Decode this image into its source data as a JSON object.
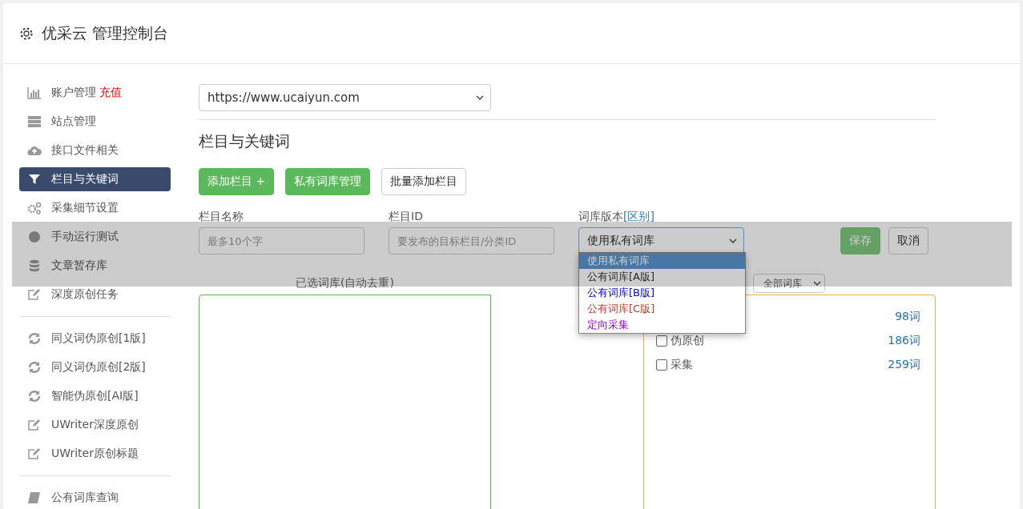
{
  "header": {
    "title": "优采云 管理控制台"
  },
  "sidebar": {
    "groups": [
      [
        {
          "label": "账户管理",
          "badge": "充值",
          "selected": false
        },
        {
          "label": "站点管理",
          "selected": false
        },
        {
          "label": "接口文件相关",
          "selected": false
        },
        {
          "label": "栏目与关键词",
          "selected": true
        },
        {
          "label": "采集细节设置",
          "selected": false
        },
        {
          "label": "手动运行测试",
          "selected": false
        },
        {
          "label": "文章暂存库",
          "selected": false
        },
        {
          "label": "深度原创任务",
          "selected": false
        }
      ],
      [
        {
          "label": "同义词伪原创[1版]",
          "selected": false
        },
        {
          "label": "同义词伪原创[2版]",
          "selected": false
        },
        {
          "label": "智能伪原创[AI版]",
          "selected": false
        },
        {
          "label": "UWriter深度原创",
          "selected": false
        },
        {
          "label": "UWriter原创标题",
          "selected": false
        }
      ],
      [
        {
          "label": "公有词库查询",
          "selected": false
        }
      ]
    ]
  },
  "site_select": {
    "value": "https://www.ucaiyun.com"
  },
  "section_title": "栏目与关键词",
  "buttons": [
    {
      "label": "添加栏目 +",
      "kind": "primary"
    },
    {
      "label": "私有词库管理",
      "kind": "primary"
    },
    {
      "label": "批量添加栏目",
      "kind": "default"
    }
  ],
  "form": {
    "name": {
      "label": "栏目名称",
      "placeholder": "最多10个字"
    },
    "id": {
      "label": "栏目ID",
      "placeholder": "要发布的目标栏目/分类ID"
    },
    "version": {
      "label": "词库版本",
      "link": "[区别]",
      "value": "使用私有词库",
      "options": [
        {
          "label": "使用私有词库",
          "selected": true
        },
        {
          "label": "公有词库[A版]",
          "selected": false,
          "color": "#333333"
        },
        {
          "label": "公有词库[B版]",
          "selected": false,
          "color": "#0000ee"
        },
        {
          "label": "公有词库[C版]",
          "selected": false,
          "color": "#c0392b"
        },
        {
          "label": "定向采集",
          "selected": false,
          "color": "#9900ee"
        }
      ]
    },
    "save": "保存",
    "cancel": "取消"
  },
  "selected_panel": {
    "title": "已选词库(自动去重)"
  },
  "library_panel": {
    "filter": "全部词库",
    "rows": [
      {
        "count": "98词"
      },
      {
        "label": "伪原创",
        "count": "186词",
        "checked": false
      },
      {
        "label": "采集",
        "count": "259词",
        "checked": false
      }
    ]
  }
}
